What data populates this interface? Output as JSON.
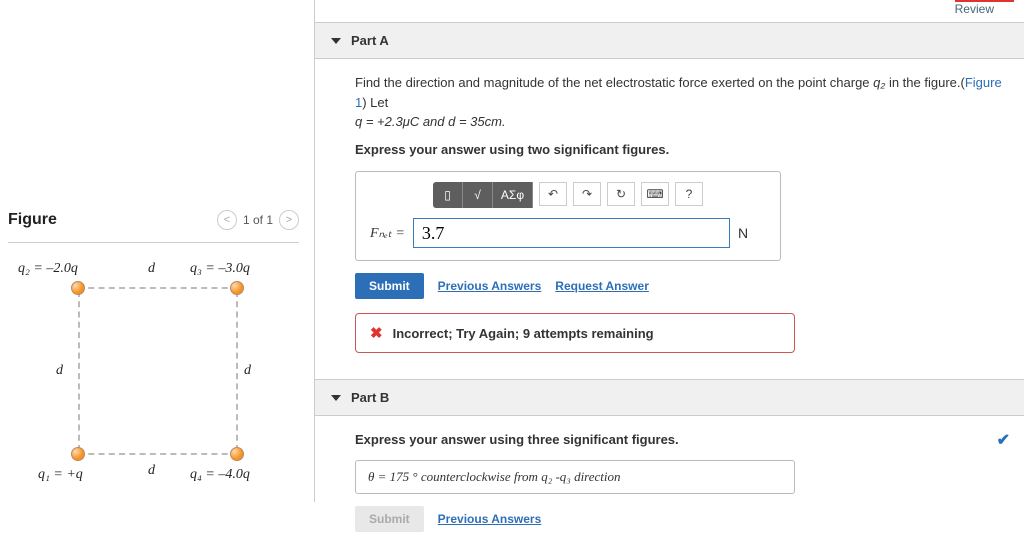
{
  "review_link": "Review",
  "figure": {
    "title": "Figure",
    "nav_text": "1 of 1",
    "labels": {
      "q2": "q₂ = –2.0q",
      "q3": "q₃ = –3.0q",
      "q1": "q₁ = +q",
      "q4": "q₄ = –4.0q",
      "d": "d"
    }
  },
  "partA": {
    "title": "Part A",
    "prompt_1": "Find the direction and magnitude of the net electrostatic force exerted on the point charge ",
    "prompt_q": "q₂",
    "prompt_2": " in the figure.(",
    "fig_link": "Figure 1",
    "prompt_3": ") Let ",
    "prompt_eq": "q = +2.3μC and d = 35cm.",
    "express": "Express your answer using two significant figures.",
    "toolbar": {
      "sqrt": "√",
      "greek": "ΑΣφ",
      "undo": "↶",
      "redo": "↷",
      "reset": "↻",
      "keys": "⌨",
      "help": "?"
    },
    "ans_label": "Fₙₑₜ =",
    "ans_value": "3.7",
    "ans_unit": "N",
    "submit": "Submit",
    "prev": "Previous Answers",
    "req": "Request Answer",
    "feedback": "Incorrect; Try Again; 9 attempts remaining"
  },
  "partB": {
    "title": "Part B",
    "express": "Express your answer using three significant figures.",
    "ans_text": "θ =  175  °  counterclockwise from q₂ -q₃  direction",
    "submit": "Submit",
    "prev": "Previous Answers"
  }
}
